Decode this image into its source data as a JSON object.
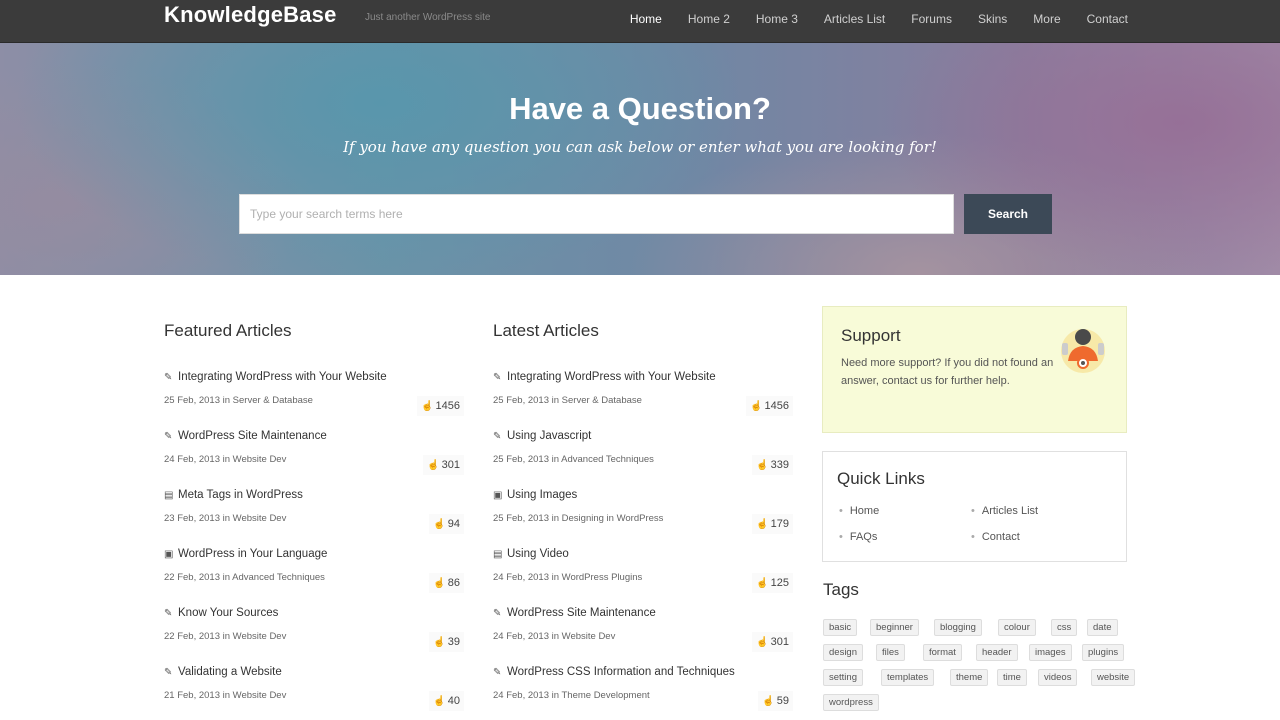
{
  "header": {
    "brand": "KnowledgeBase",
    "tagline": "Just another WordPress site",
    "nav": [
      "Home",
      "Home 2",
      "Home 3",
      "Articles List",
      "Forums",
      "Skins",
      "More",
      "Contact"
    ]
  },
  "hero": {
    "title": "Have a Question?",
    "subtitle": "If you have any question you can ask below or enter what you are looking for!",
    "search_placeholder": "Type your search terms here",
    "search_button": "Search"
  },
  "featured": {
    "title": "Featured Articles",
    "items": [
      {
        "icon": "edit-icon",
        "title": "Integrating WordPress with Your Website",
        "meta": "25 Feb, 2013 in Server & Database",
        "likes": "1456"
      },
      {
        "icon": "edit-icon",
        "title": "WordPress Site Maintenance",
        "meta": "24 Feb, 2013 in Website Dev",
        "likes": "301"
      },
      {
        "icon": "video-icon",
        "title": "Meta Tags in WordPress",
        "meta": "23 Feb, 2013 in Website Dev",
        "likes": "94"
      },
      {
        "icon": "image-icon",
        "title": "WordPress in Your Language",
        "meta": "22 Feb, 2013 in Advanced Techniques",
        "likes": "86"
      },
      {
        "icon": "edit-icon",
        "title": "Know Your Sources",
        "meta": "22 Feb, 2013 in Website Dev",
        "likes": "39"
      },
      {
        "icon": "edit-icon",
        "title": "Validating a Website",
        "meta": "21 Feb, 2013 in Website Dev",
        "likes": "40"
      }
    ]
  },
  "latest": {
    "title": "Latest Articles",
    "items": [
      {
        "icon": "edit-icon",
        "title": "Integrating WordPress with Your Website",
        "meta": "25 Feb, 2013 in Server & Database",
        "likes": "1456"
      },
      {
        "icon": "edit-icon",
        "title": "Using Javascript",
        "meta": "25 Feb, 2013 in Advanced Techniques",
        "likes": "339"
      },
      {
        "icon": "image-icon",
        "title": "Using Images",
        "meta": "25 Feb, 2013 in Designing in WordPress",
        "likes": "179"
      },
      {
        "icon": "video-icon",
        "title": "Using Video",
        "meta": "24 Feb, 2013 in WordPress Plugins",
        "likes": "125"
      },
      {
        "icon": "edit-icon",
        "title": "WordPress Site Maintenance",
        "meta": "24 Feb, 2013 in Website Dev",
        "likes": "301"
      },
      {
        "icon": "edit-icon",
        "title": "WordPress CSS Information and Techniques",
        "meta": "24 Feb, 2013 in Theme Development",
        "likes": "59"
      }
    ]
  },
  "support": {
    "title": "Support",
    "text": "Need more support? If you did not found an answer, contact us for further help."
  },
  "quick_links": {
    "title": "Quick Links",
    "links": [
      "Home",
      "Articles List",
      "FAQs",
      "Contact"
    ]
  },
  "tags": {
    "title": "Tags",
    "items": [
      "basic",
      "beginner",
      "blogging",
      "colour",
      "css",
      "date",
      "design",
      "files",
      "format",
      "header",
      "images",
      "plugins",
      "setting",
      "templates",
      "theme",
      "time",
      "videos",
      "website",
      "wordpress"
    ]
  },
  "colors": {
    "topbar": "#3b3b3b",
    "search_button": "#3c4957",
    "support_bg": "#f8fbd8"
  }
}
